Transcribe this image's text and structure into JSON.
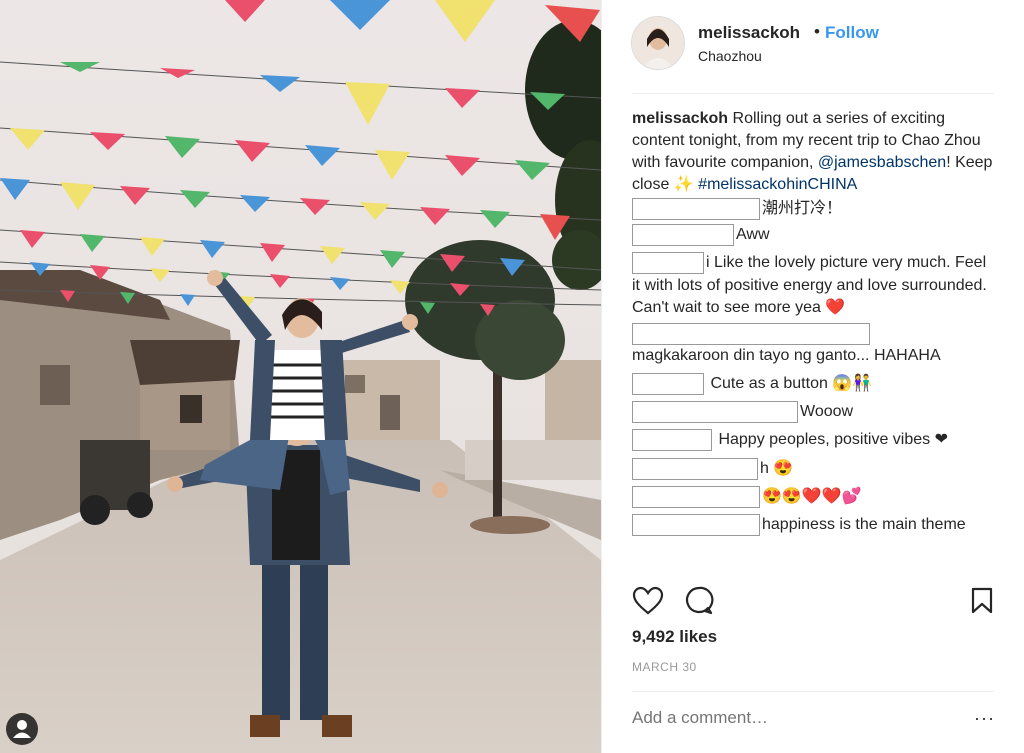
{
  "post": {
    "username": "melissackoh",
    "separator": "•",
    "follow_label": "Follow",
    "location": "Chaozhou"
  },
  "caption": {
    "username": "melissackoh",
    "text_1": " Rolling out a series of exciting content tonight, from my recent trip to Chao Zhou with favourite companion, ",
    "mention": "@jamesbabschen",
    "text_2": "! Keep close ",
    "sparkle": "✨",
    "hashtag": "#melissackohinCHINA"
  },
  "comments": [
    {
      "text": "潮州打冷！"
    },
    {
      "text": "Aww"
    },
    {
      "text": "i Like the lovely picture very much. Feel it with lots of positive energy and love surrounded. Can't wait to see more yea ❤️"
    },
    {
      "text": "magkakaroon din tayo ng ganto... HAHAHA"
    },
    {
      "text": "Cute as a button 😱👫"
    },
    {
      "text": "Wooow"
    },
    {
      "text": "Happy peoples, positive vibes ❤"
    },
    {
      "text": "h 😍"
    },
    {
      "text": "😍😍❤️❤️💕"
    },
    {
      "text": "happiness is the main theme"
    }
  ],
  "actions": {
    "like_icon": "heart-icon",
    "comment_icon": "comment-icon",
    "save_icon": "bookmark-icon"
  },
  "likes": "9,492 likes",
  "date": "MARCH 30",
  "add_comment_placeholder": "Add a comment…",
  "more_label": "···",
  "colors": {
    "follow": "#3897f0",
    "link": "#003569",
    "text": "#262626",
    "muted": "#999999"
  }
}
